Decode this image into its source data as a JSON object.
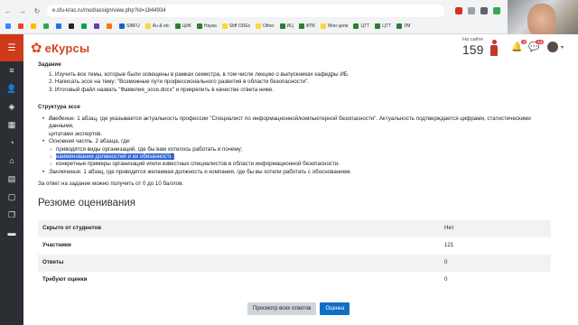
{
  "browser": {
    "url": "e.sfu-kras.ru/mod/assign/view.php?id=1844934",
    "bookmarks": [
      "",
      "",
      "",
      "",
      "",
      "",
      "",
      "",
      "",
      "SIBFU",
      "Au & etc",
      "ЦИК",
      "Наука",
      "Stiff ODEs",
      "Other",
      "ИЦ",
      "ФПК",
      "Мои цели",
      "ЦТТ",
      "ЦТТ",
      "УМ"
    ]
  },
  "header": {
    "logo_text": "eКурсы",
    "online_label": "На сайте",
    "online_count": "159",
    "notif_count": "1",
    "msg_count": "14"
  },
  "task": {
    "heading": "Задание",
    "steps": [
      "1. Изучить все темы, которые были освещены в рамках семестра, в том числе лекцию о выпускниках кафедры ИБ.",
      "2. Написать эссе на тему: \"Возможные пути профессионального развития в области безопасности\".",
      "3. Итоговый файл назвать \"Фамилия_эссе.docx\" и прикрепить в качестве ответа ниже."
    ]
  },
  "structure": {
    "heading": "Структура эссе",
    "intro_label": "Введение.",
    "intro_text": " 1 абзац, где указывается актуальность профессии \"Специалист по информационной/компьютерной безопасности\". Актуальность подтверждается цифрами, статистическими данными,",
    "intro_text2": "цитатами экспертов.",
    "main_label": "Основная часть.",
    "main_text": " 2 абзаца, где:",
    "sub1": "приводятся виды организаций, где бы вам хотелось работать и почему;",
    "sub2": "наименования должностей и их обязанности;",
    "sub3": "конкретные примеры организаций и/или известных специалистов в области информационной безопасности.",
    "concl_label": "Заключение.",
    "concl_text": " 1 абзац, где приводится желаемая должность и компания, где бы вы хотели работать с обоснованием.",
    "score_note": "За ответ на задание можно получить от 0 до 10 баллов."
  },
  "grading": {
    "title": "Резюме оценивания",
    "rows": [
      {
        "label": "Скрыто от студентов",
        "value": "Нет"
      },
      {
        "label": "Участники",
        "value": "121"
      },
      {
        "label": "Ответы",
        "value": "0"
      },
      {
        "label": "Требуют оценки",
        "value": "0"
      }
    ],
    "view_all_label": "Просмотр всех ответов",
    "grade_label": "Оценка"
  }
}
